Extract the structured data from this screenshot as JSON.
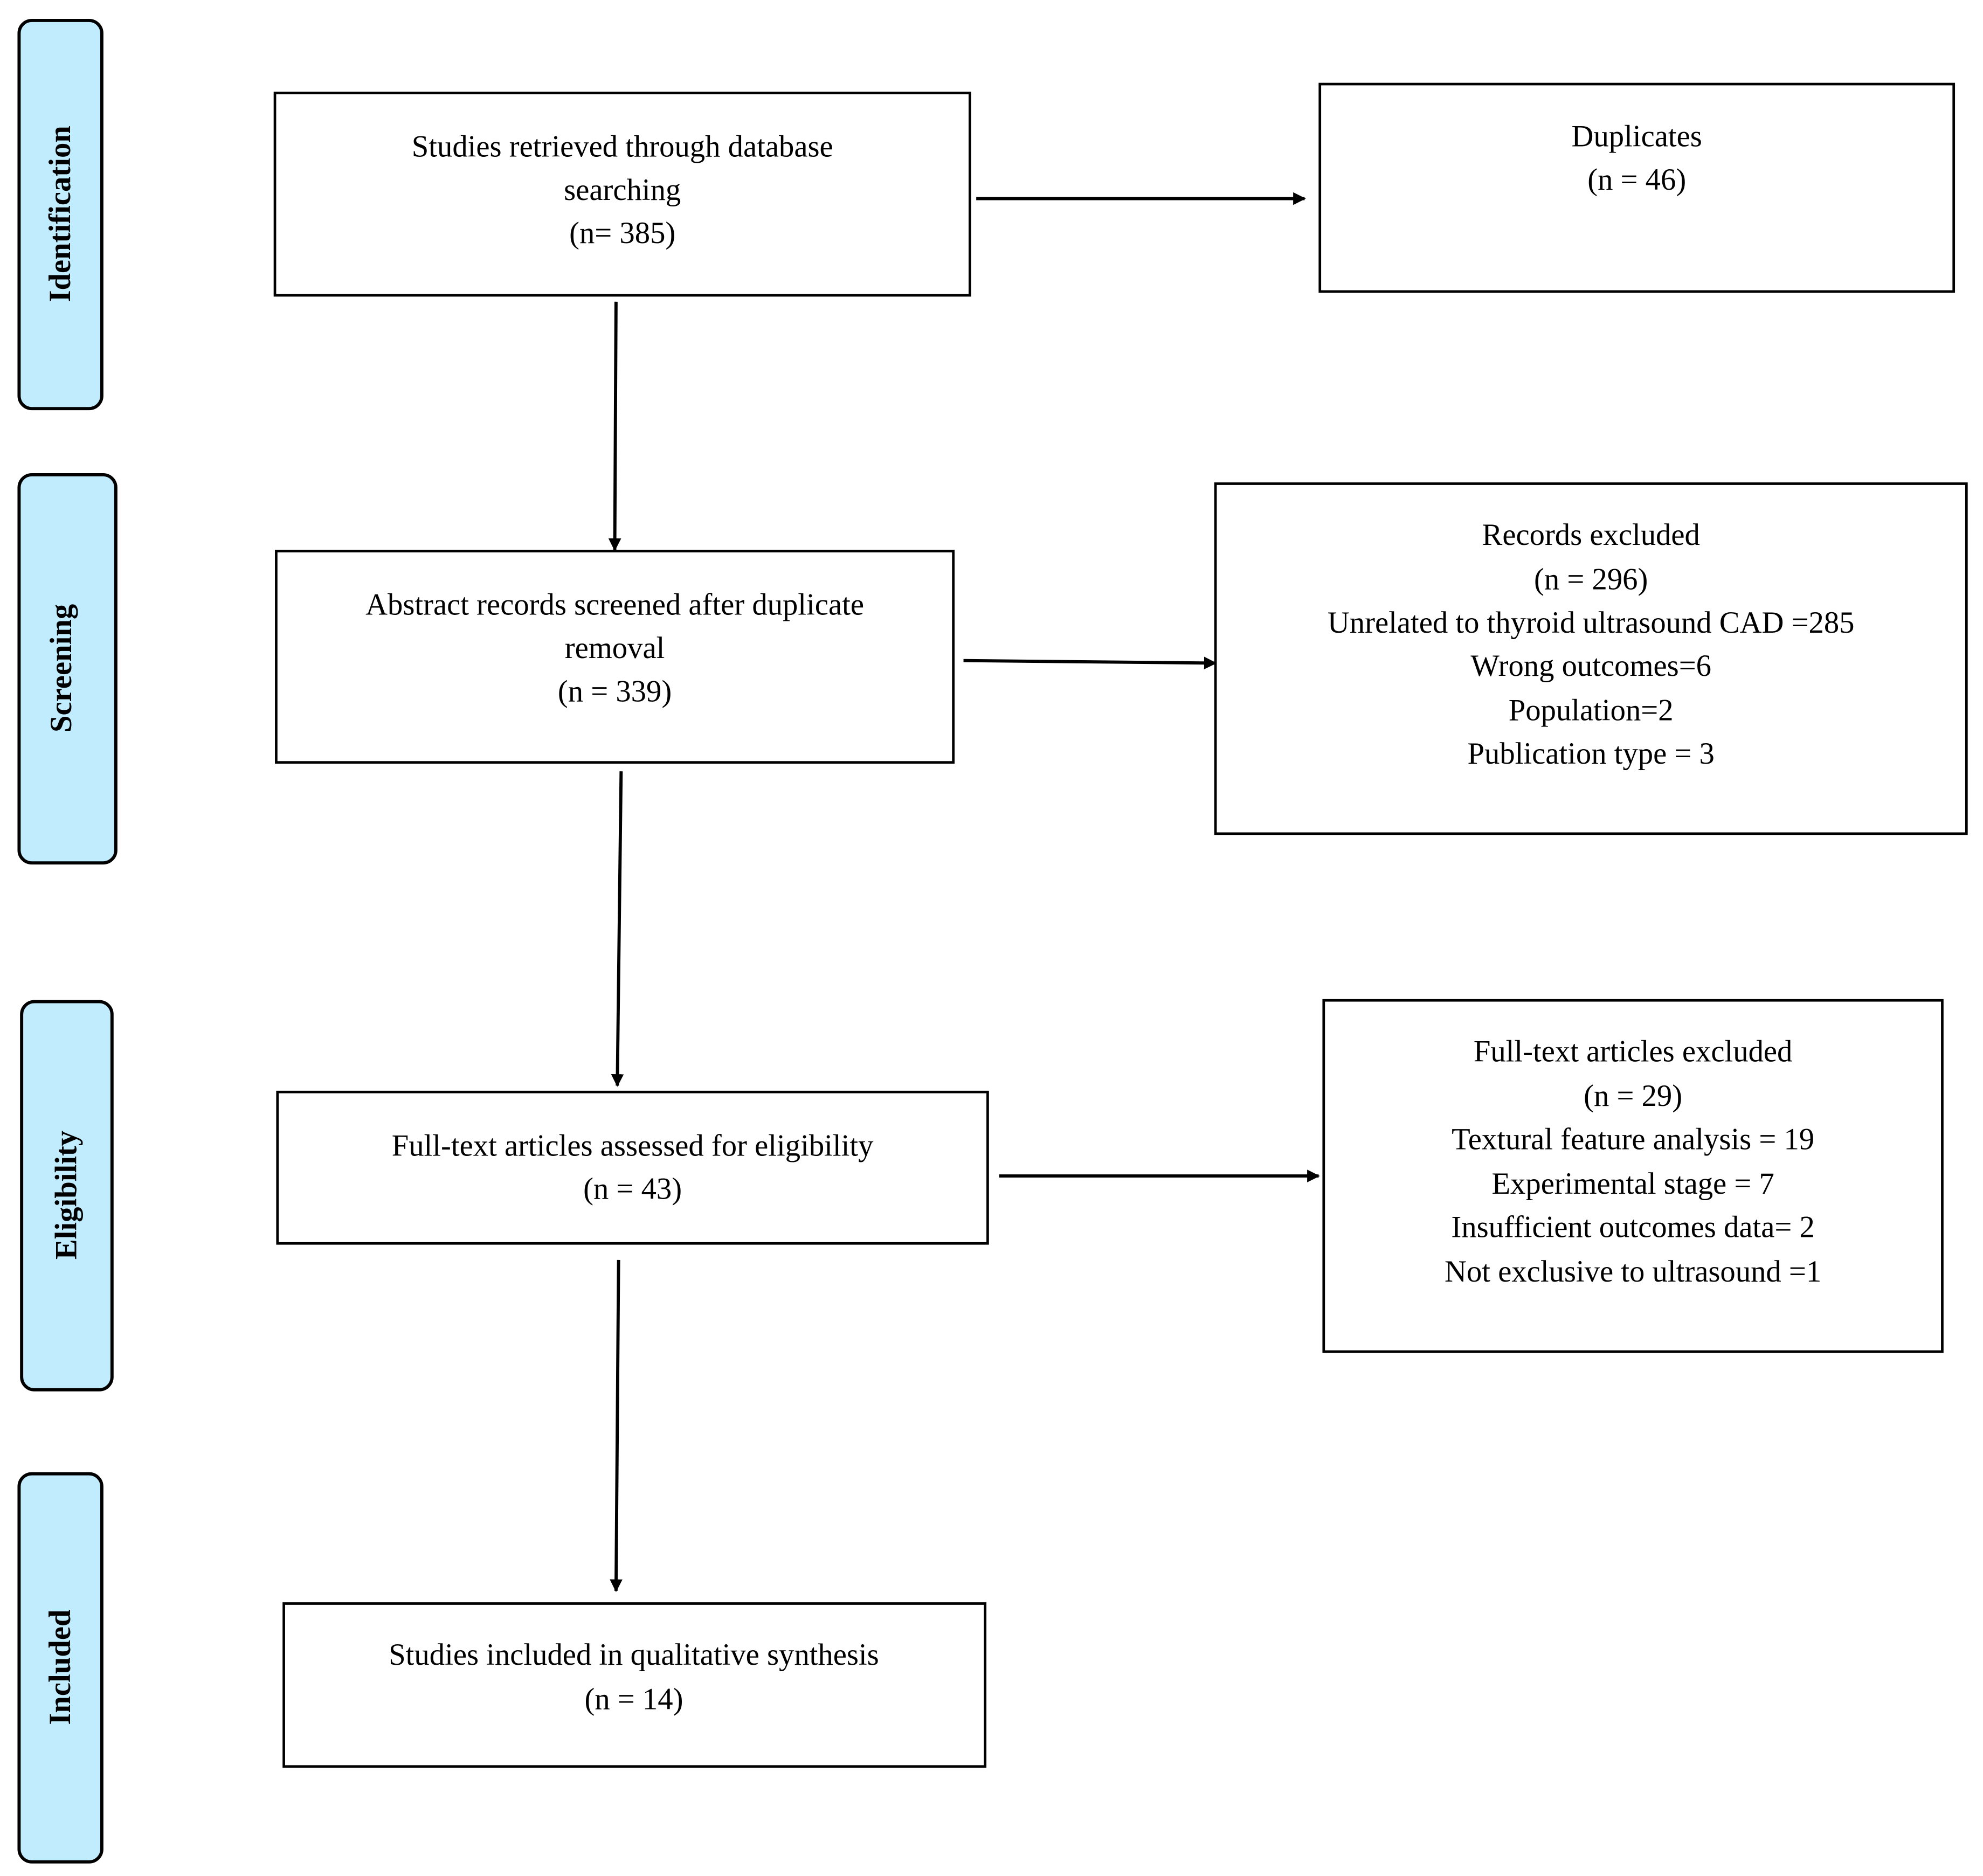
{
  "colors": {
    "stage_fill": "#c0ecfd",
    "border": "#000000"
  },
  "stages": [
    {
      "label": "Identification"
    },
    {
      "label": "Screening"
    },
    {
      "label": "Eligibility"
    },
    {
      "label": "Included"
    }
  ],
  "boxes": {
    "retrieved": {
      "lines": [
        "Studies retrieved through database",
        "searching",
        "(n= 385)"
      ]
    },
    "duplicates": {
      "lines": [
        "Duplicates",
        "(n = 46)"
      ]
    },
    "screened": {
      "lines": [
        "Abstract records screened after duplicate",
        "removal",
        "(n = 339)"
      ]
    },
    "records_excluded": {
      "lines": [
        "Records excluded",
        "(n = 296)",
        "Unrelated to thyroid ultrasound CAD =285",
        "Wrong outcomes=6",
        "Population=2",
        "Publication type = 3"
      ]
    },
    "assessed": {
      "lines": [
        "Full-text articles assessed for eligibility",
        "(n = 43)"
      ]
    },
    "fulltext_excluded": {
      "lines": [
        "Full-text articles excluded",
        "(n = 29)",
        "Textural feature analysis = 19",
        "Experimental stage = 7",
        "Insufficient outcomes data= 2",
        "Not exclusive to ultrasound =1"
      ]
    },
    "included": {
      "lines": [
        "Studies included in qualitative synthesis",
        "(n = 14)"
      ]
    }
  }
}
